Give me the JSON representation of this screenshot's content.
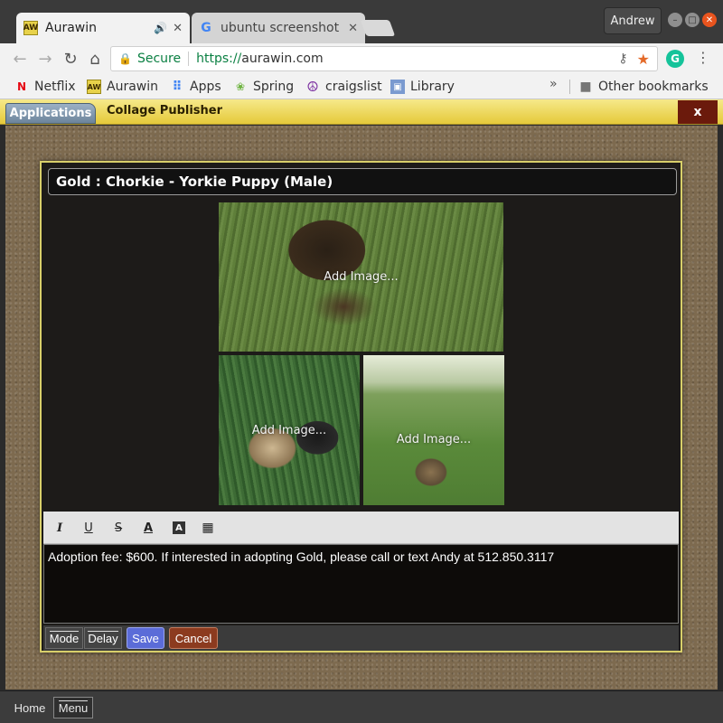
{
  "browser": {
    "tabs": [
      {
        "title": "Aurawin",
        "favicon": "aurawin-icon",
        "active": true
      },
      {
        "title": "ubuntu screenshot",
        "favicon": "google-icon",
        "active": false
      }
    ],
    "profile_name": "Andrew",
    "address": {
      "secure_label": "Secure",
      "scheme": "https://",
      "host": "aurawin.com"
    },
    "bookmarks": [
      {
        "label": "Netflix",
        "icon": "netflix-icon"
      },
      {
        "label": "Aurawin",
        "icon": "aurawin-icon"
      },
      {
        "label": "Apps",
        "icon": "apps-grid-icon"
      },
      {
        "label": "Spring",
        "icon": "spring-icon"
      },
      {
        "label": "craigslist",
        "icon": "peace-icon"
      },
      {
        "label": "Library",
        "icon": "library-icon"
      }
    ],
    "bookmarks_overflow": "»",
    "other_bookmarks": "Other bookmarks"
  },
  "appbar": {
    "applications_label": "Applications",
    "app_title": "Collage Publisher",
    "close_label": "x"
  },
  "dialog": {
    "title": "Gold : Chorkie - Yorkie Puppy (Male)",
    "image_slots": [
      {
        "label": "Add Image..."
      },
      {
        "label": "Add Image..."
      },
      {
        "label": "Add Image..."
      }
    ],
    "editor_text": "Adoption fee: $600. If interested in adopting Gold, please call or text Andy at 512.850.3117",
    "toolbar": {
      "italic": "I",
      "underline": "U",
      "strike": "S",
      "font_color": "A",
      "bg_color": "A",
      "table": "▦"
    },
    "buttons": {
      "mode": "Mode",
      "delay": "Delay",
      "save": "Save",
      "cancel": "Cancel"
    }
  },
  "taskbar": {
    "home": "Home",
    "menu": "Menu"
  },
  "colors": {
    "accent_yellow": "#e5c93a",
    "save_blue": "#5b6cd8",
    "cancel_brown": "#8c3b1f",
    "secure_green": "#0b8043"
  }
}
